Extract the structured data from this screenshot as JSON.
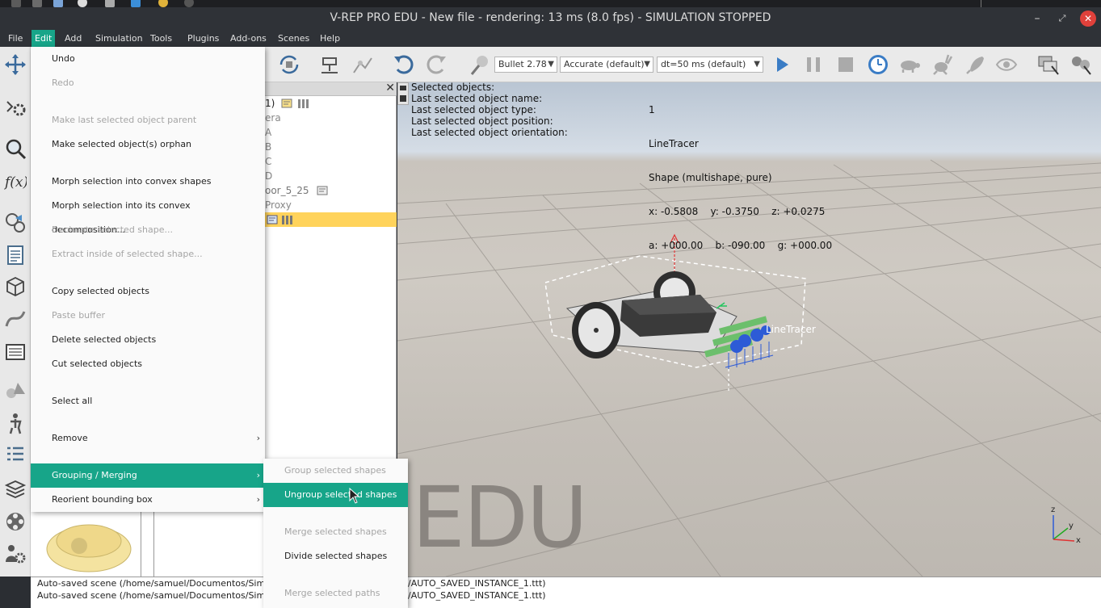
{
  "window": {
    "title": "V-REP PRO EDU - New file - rendering: 13 ms (8.0 fps) - SIMULATION STOPPED",
    "minimize": "–",
    "maximize": "⤢",
    "close": "✕"
  },
  "menubar": [
    "File",
    "Edit",
    "Add",
    "Simulation",
    "Tools",
    "Plugins",
    "Add-ons",
    "Scenes",
    "Help"
  ],
  "toolbar": {
    "physics_engine": "Bullet 2.78",
    "accuracy": "Accurate (default)",
    "timestep": "dt=50 ms (default)"
  },
  "hierarchy": {
    "rows": [
      "1)",
      "era",
      "A",
      "B",
      "C",
      "D",
      "oor_5_25",
      "Proxy",
      ""
    ]
  },
  "viewport": {
    "info_labels": [
      "Selected objects:",
      "Last selected object name:",
      "Last selected object type:",
      "Last selected object position:",
      "Last selected object orientation:"
    ],
    "info_values": [
      "1",
      "LineTracer",
      "Shape (multishape, pure)",
      "x: -0.5808    y: -0.3750    z: +0.0275",
      "a: +000.00    b: -090.00    g: +000.00"
    ],
    "object_label": "LineTracer",
    "watermark": "EDU",
    "axis_x": "x",
    "axis_y": "y",
    "axis_z": "z"
  },
  "console": {
    "lines": [
      "Auto-saved scene (/home/samuel/Documentos/Simulador/",
      "Auto-saved scene (/home/samuel/Documentos/Simulador/"
    ],
    "tail": "/AUTO_SAVED_INSTANCE_1.ttt)"
  },
  "edit_menu": {
    "items": [
      {
        "label": "Undo",
        "enabled": true
      },
      {
        "label": "Redo",
        "enabled": false
      },
      {
        "label": "Make last selected object parent",
        "enabled": false
      },
      {
        "label": "Make selected object(s) orphan",
        "enabled": true
      },
      {
        "label": "Morph selection into convex shapes",
        "enabled": true
      },
      {
        "label": "Morph selection into its convex decomposition...",
        "enabled": true
      },
      {
        "label": "Decimate selected shape...",
        "enabled": false
      },
      {
        "label": "Extract inside of selected shape...",
        "enabled": false
      },
      {
        "label": "Copy selected objects",
        "enabled": true
      },
      {
        "label": "Paste buffer",
        "enabled": false
      },
      {
        "label": "Delete selected objects",
        "enabled": true
      },
      {
        "label": "Cut selected objects",
        "enabled": true
      },
      {
        "label": "Select all",
        "enabled": true
      },
      {
        "label": "Remove",
        "enabled": true
      },
      {
        "label": "Grouping / Merging",
        "enabled": true
      },
      {
        "label": "Reorient bounding box",
        "enabled": true
      }
    ],
    "submenu_arrow": "›"
  },
  "grouping_submenu": {
    "items": [
      {
        "label": "Group selected shapes",
        "enabled": false
      },
      {
        "label": "Ungroup selected shapes",
        "enabled": true
      },
      {
        "label": "Merge selected shapes",
        "enabled": false
      },
      {
        "label": "Divide selected shapes",
        "enabled": true
      },
      {
        "label": "Merge selected paths",
        "enabled": false
      }
    ]
  },
  "colors": {
    "accent": "#17a589",
    "selection": "#ffd35b",
    "close": "#e0413b"
  }
}
